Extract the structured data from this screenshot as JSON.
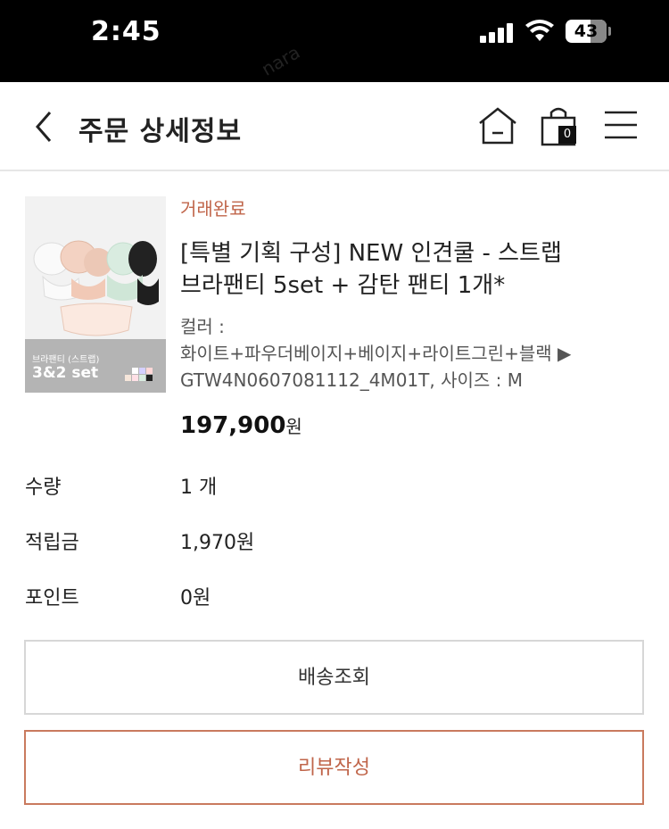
{
  "status_bar": {
    "time": "2:45",
    "battery": "43",
    "watermark": "nara"
  },
  "header": {
    "title": "주문 상세정보",
    "cart_count": "0"
  },
  "order": {
    "status": "거래완료",
    "product_name_line1": "[특별 기획 구성] NEW 인견쿨 - 스트랩",
    "product_name_line2": "브라팬티 5set + 감탄 팬티 1개*",
    "option_label": "컬러 :",
    "option_line1": "화이트+파우더베이지+베이지+라이트그린+블랙 ▶",
    "option_line2": "GTW4N0607081112_4M01T, 사이즈 : M",
    "price": "197,900",
    "price_unit": "원",
    "thumb_label_small": "브라팬티 (스트랩)",
    "thumb_label_big": "3&2 set"
  },
  "info": [
    {
      "key": "수량",
      "value": "1 개"
    },
    {
      "key": "적립금",
      "value": "1,970원"
    },
    {
      "key": "포인트",
      "value": "0원"
    }
  ],
  "buttons": {
    "track": "배송조회",
    "review": "리뷰작성"
  },
  "colors": {
    "accent": "#c0654a",
    "border": "#d7d7d7"
  }
}
